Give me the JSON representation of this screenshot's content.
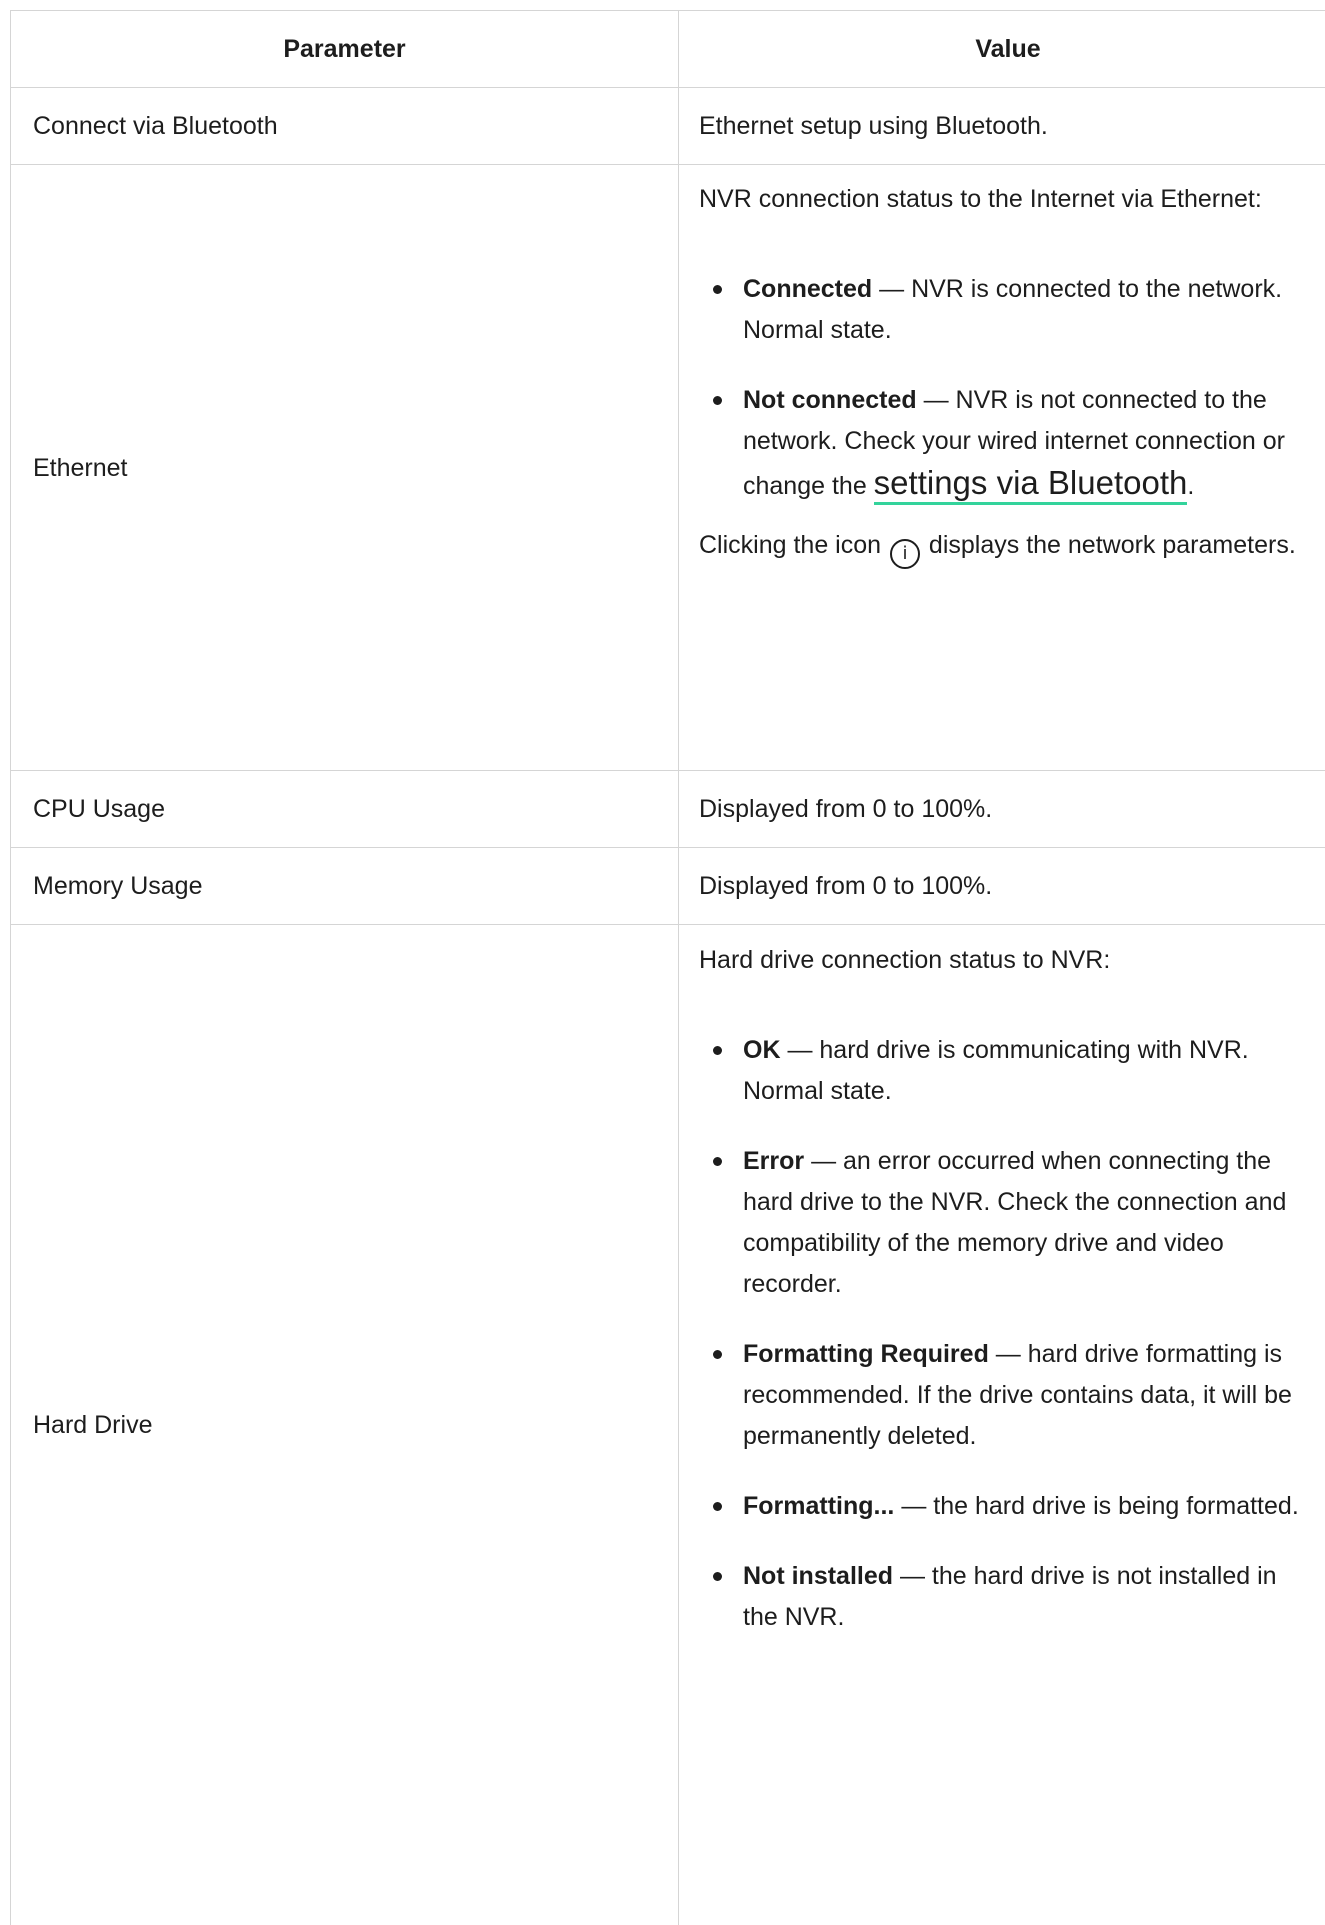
{
  "table": {
    "headers": {
      "parameter": "Parameter",
      "value": "Value"
    },
    "rows": {
      "bluetooth": {
        "param": "Connect via Bluetooth",
        "value": "Ethernet setup using Bluetooth."
      },
      "ethernet": {
        "param": "Ethernet",
        "intro": "NVR connection status to the Internet via Ethernet:",
        "items": [
          {
            "term": "Connected",
            "desc": " — NVR is connected to the network. Normal state."
          },
          {
            "term": "Not connected",
            "desc": " — NVR is not connected to the network. Check your wired internet connection or change the ",
            "link": "settings via Bluetooth",
            "after": "."
          }
        ],
        "icon_before": "Clicking the icon ",
        "icon_glyph": "i",
        "icon_name": "info-icon",
        "icon_after": " displays the network parameters."
      },
      "cpu": {
        "param": "CPU Usage",
        "value": "Displayed from 0 to 100%."
      },
      "memory": {
        "param": "Memory Usage",
        "value": "Displayed from 0 to 100%."
      },
      "hdd": {
        "param": "Hard Drive",
        "intro": "Hard drive connection status to NVR:",
        "items": [
          {
            "term": "OK",
            "desc": " — hard drive is communicating with NVR. Normal state."
          },
          {
            "term": "Error",
            "desc": " — an error occurred when connecting the hard drive to the NVR. Check the connection and compatibility of the memory drive and video recorder."
          },
          {
            "term": "Formatting Required",
            "desc": " — hard drive formatting is recommended. If the drive contains data, it will be permanently deleted."
          },
          {
            "term": "Formatting...",
            "desc": " — the hard drive is being formatted."
          },
          {
            "term": "Not installed",
            "desc": " — the hard drive is not installed in the NVR."
          }
        ]
      }
    }
  },
  "colors": {
    "border": "#d5d5d5",
    "text": "#1d1d1d",
    "link_underline": "#33d39b"
  }
}
